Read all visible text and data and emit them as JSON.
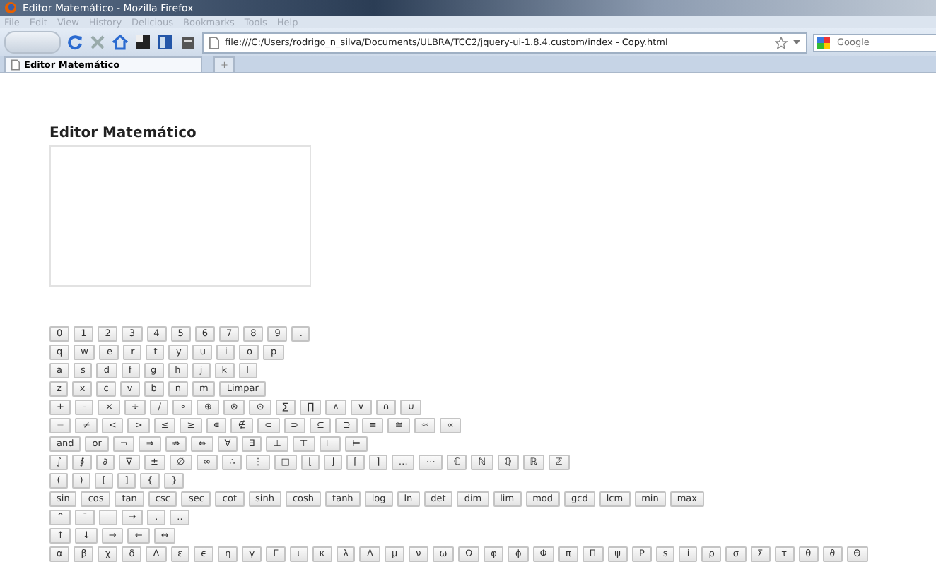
{
  "window": {
    "title": "Editor Matemático - Mozilla Firefox"
  },
  "menu": [
    "File",
    "Edit",
    "View",
    "History",
    "Delicious",
    "Bookmarks",
    "Tools",
    "Help"
  ],
  "address": {
    "value": "file:///C:/Users/rodrigo_n_silva/Documents/ULBRA/TCC2/jquery-ui-1.8.4.custom/index - Copy.html"
  },
  "search": {
    "placeholder": "Google"
  },
  "tabs": [
    {
      "label": "Editor Matemático",
      "selected": true
    },
    {
      "label": "+",
      "selected": false
    }
  ],
  "page": {
    "heading": "Editor Matemático",
    "key_rows": [
      [
        "0",
        "1",
        "2",
        "3",
        "4",
        "5",
        "6",
        "7",
        "8",
        "9",
        "."
      ],
      [
        "q",
        "w",
        "e",
        "r",
        "t",
        "y",
        "u",
        "i",
        "o",
        "p"
      ],
      [
        "a",
        "s",
        "d",
        "f",
        "g",
        "h",
        "j",
        "k",
        "l"
      ],
      [
        "z",
        "x",
        "c",
        "v",
        "b",
        "n",
        "m",
        "Limpar"
      ],
      [
        "+",
        "-",
        "×",
        "÷",
        "/",
        "∘",
        "⊕",
        "⊗",
        "⊙",
        "∑",
        "∏",
        "∧",
        "∨",
        "∩",
        "∪"
      ],
      [
        "=",
        "≠",
        "<",
        ">",
        "≤",
        "≥",
        "∊",
        "∉",
        "⊂",
        "⊃",
        "⊆",
        "⊇",
        "≡",
        "≅",
        "≈",
        "∝"
      ],
      [
        "and",
        "or",
        "¬",
        "⇒",
        "⇏",
        "⇔",
        "∀",
        "∃",
        "⊥",
        "⊤",
        "⊢",
        "⊨"
      ],
      [
        "∫",
        "∮",
        "∂",
        "∇",
        "±",
        "∅",
        "∞",
        "∴",
        "⋮",
        "□",
        "⌊",
        "⌋",
        "⌈",
        "⌉",
        "…",
        "⋯",
        "ℂ",
        "ℕ",
        "ℚ",
        "ℝ",
        "ℤ"
      ],
      [
        "(",
        ")",
        "[",
        "]",
        "{",
        "}"
      ],
      [
        "sin",
        "cos",
        "tan",
        "csc",
        "sec",
        "cot",
        "sinh",
        "cosh",
        "tanh",
        "log",
        "ln",
        "det",
        "dim",
        "lim",
        "mod",
        "gcd",
        "lcm",
        "min",
        "max"
      ],
      [
        "^",
        "¯",
        null,
        "→",
        ".",
        ".."
      ],
      [
        "↑",
        "↓",
        "→",
        "←",
        "↔"
      ],
      [
        "α",
        "β",
        "χ",
        "δ",
        "Δ",
        "ε",
        "ϵ",
        "η",
        "γ",
        "Γ",
        "ι",
        "κ",
        "λ",
        "Λ",
        "μ",
        "ν",
        "ω",
        "Ω",
        "φ",
        "ϕ",
        "Φ",
        "π",
        "Π",
        "ψ",
        "P",
        "s",
        "i",
        "ρ",
        "σ",
        "Σ",
        "τ",
        "θ",
        "ϑ",
        "Θ"
      ]
    ]
  }
}
